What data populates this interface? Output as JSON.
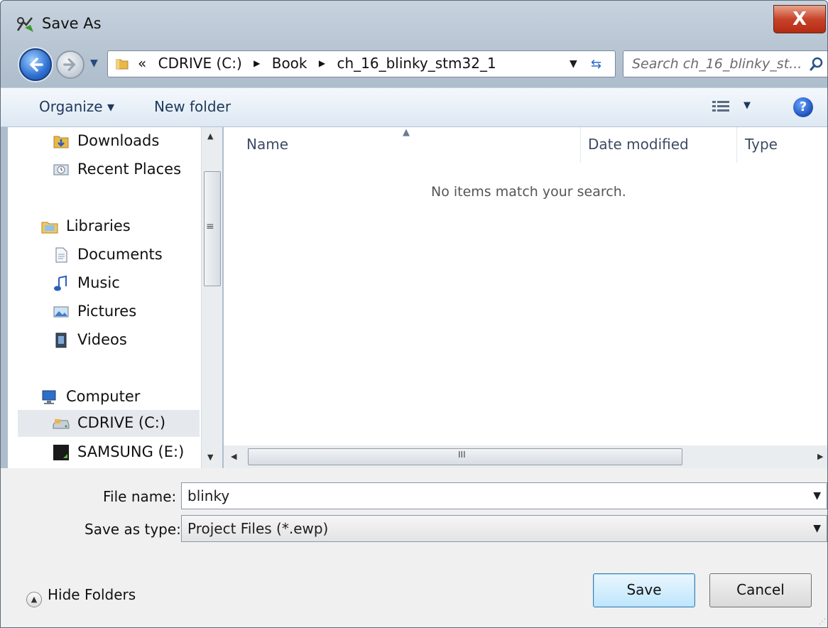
{
  "window": {
    "title": "Save As",
    "close_glyph": "X"
  },
  "address": {
    "prefix": "«",
    "breadcrumbs": [
      "CDRIVE (C:)",
      "Book",
      "ch_16_blinky_stm32_1"
    ]
  },
  "search": {
    "placeholder": "Search ch_16_blinky_st..."
  },
  "toolbar": {
    "organize": "Organize ▾",
    "new_folder": "New folder",
    "help": "?"
  },
  "nav_pane": {
    "items": [
      {
        "label": "Downloads",
        "icon": "downloads-icon"
      },
      {
        "label": "Recent Places",
        "icon": "recent-places-icon"
      },
      {
        "label": "Libraries",
        "icon": "libraries-icon"
      },
      {
        "label": "Documents",
        "icon": "documents-icon"
      },
      {
        "label": "Music",
        "icon": "music-icon"
      },
      {
        "label": "Pictures",
        "icon": "pictures-icon"
      },
      {
        "label": "Videos",
        "icon": "videos-icon"
      },
      {
        "label": "Computer",
        "icon": "computer-icon"
      },
      {
        "label": "CDRIVE (C:)",
        "icon": "drive-icon",
        "selected": true
      },
      {
        "label": "SAMSUNG (E:)",
        "icon": "usb-drive-icon"
      }
    ]
  },
  "file_list": {
    "columns": [
      "Name",
      "Date modified",
      "Type"
    ],
    "empty_message": "No items match your search.",
    "scroll_grip": "III"
  },
  "form": {
    "file_name_label": "File name:",
    "file_name_value": "blinky",
    "save_type_label": "Save as type:",
    "save_type_value": "Project Files (*.ewp)"
  },
  "footer": {
    "hide_folders": "Hide Folders",
    "save": "Save",
    "cancel": "Cancel"
  },
  "colors": {
    "accent": "#3c7fb1",
    "close": "#c7432a",
    "toolbar_text": "#1e395b"
  }
}
